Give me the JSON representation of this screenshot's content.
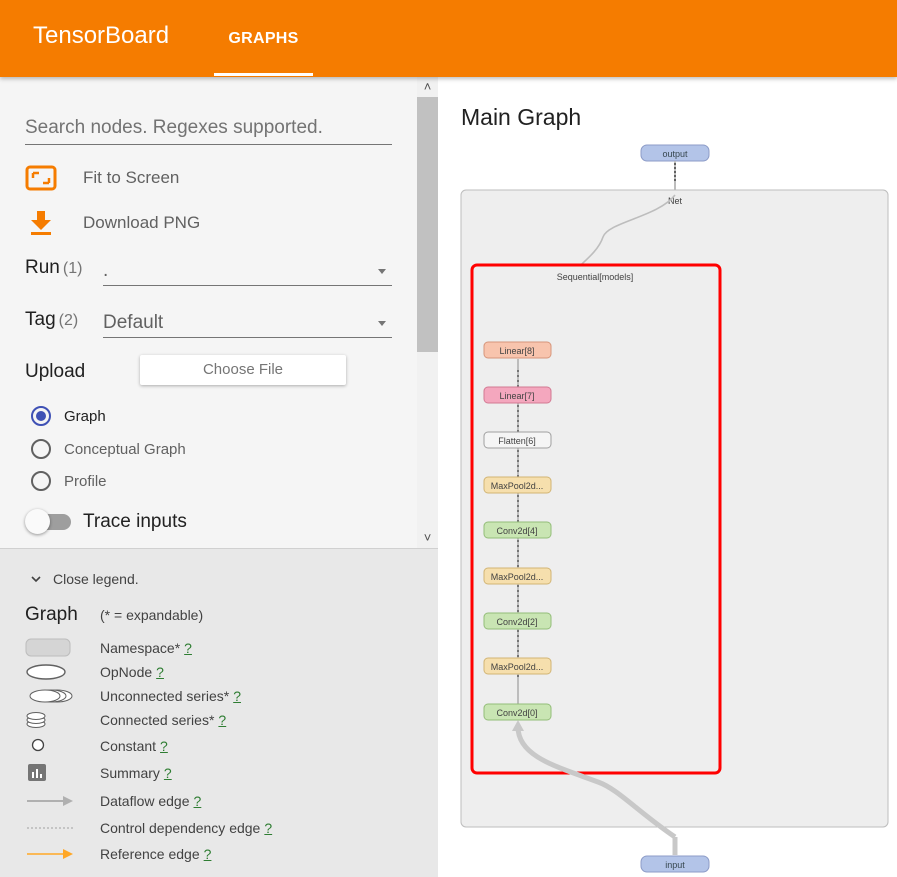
{
  "header": {
    "brand": "TensorBoard",
    "tab_graphs": "GRAPHS"
  },
  "sidebar": {
    "search_placeholder": "Search nodes. Regexes supported.",
    "fit_to_screen": "Fit to Screen",
    "download_png": "Download PNG",
    "run": {
      "label": "Run",
      "count": "(1)",
      "value": "."
    },
    "tag": {
      "label": "Tag",
      "count": "(2)",
      "value": "Default"
    },
    "upload": {
      "label": "Upload",
      "button": "Choose File"
    },
    "graph_types": [
      {
        "label": "Graph",
        "checked": true
      },
      {
        "label": "Conceptual Graph",
        "checked": false
      },
      {
        "label": "Profile",
        "checked": false
      }
    ],
    "trace_inputs": {
      "label": "Trace inputs",
      "on": false
    }
  },
  "legend": {
    "toggle_label": "Close legend.",
    "title": "Graph",
    "note": "(* = expandable)",
    "items": [
      {
        "label": "Namespace*",
        "help": "?",
        "symbol": "namespace"
      },
      {
        "label": "OpNode",
        "help": "?",
        "symbol": "opnode"
      },
      {
        "label": "Unconnected series*",
        "help": "?",
        "symbol": "unconnected-series"
      },
      {
        "label": "Connected series*",
        "help": "?",
        "symbol": "connected-series"
      },
      {
        "label": "Constant",
        "help": "?",
        "symbol": "constant"
      },
      {
        "label": "Summary",
        "help": "?",
        "symbol": "summary"
      },
      {
        "label": "Dataflow edge",
        "help": "?",
        "symbol": "dataflow-edge"
      },
      {
        "label": "Control dependency edge",
        "help": "?",
        "symbol": "control-edge"
      },
      {
        "label": "Reference edge",
        "help": "?",
        "symbol": "reference-edge"
      }
    ]
  },
  "graph": {
    "title": "Main Graph",
    "output_node": "output",
    "input_node": "input",
    "net_label": "Net",
    "sequential_label": "Sequential[models]",
    "layers": [
      "Linear[8]",
      "Linear[7]",
      "Flatten[6]",
      "MaxPool2d...",
      "Conv2d[4]",
      "MaxPool2d...",
      "Conv2d[2]",
      "MaxPool2d...",
      "Conv2d[0]"
    ],
    "colors": {
      "header": "#f57c00",
      "linear8": "#f8c4ad",
      "linear7": "#f4a7be",
      "flatten": "#f5f5f5",
      "maxpool": "#f6dfad",
      "conv": "#c9e5b3",
      "io": "#b3c4e8",
      "highlight": "#ff0000"
    }
  }
}
